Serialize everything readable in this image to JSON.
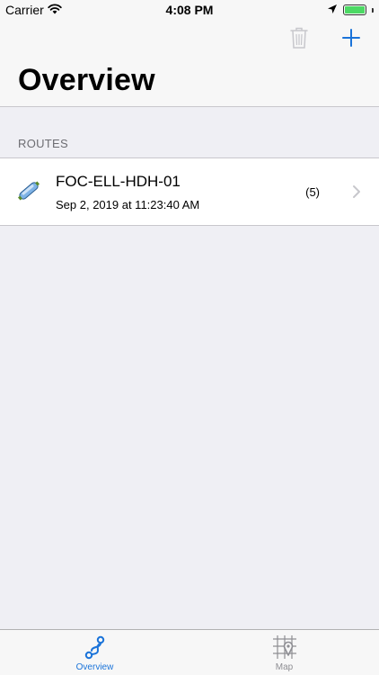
{
  "status_bar": {
    "carrier": "Carrier",
    "time": "4:08 PM",
    "battery_level": 1.0,
    "icons": [
      "wifi-icon",
      "location-arrow-icon",
      "battery-icon"
    ]
  },
  "nav": {
    "title": "Overview",
    "icons": [
      "trash-icon",
      "plus-icon"
    ],
    "trash_enabled": false,
    "accent_color": "#1a73d9"
  },
  "routes": {
    "section_header": "ROUTES",
    "items": [
      {
        "name": "FOC-ELL-HDH-01",
        "date": "Sep 2, 2019 at 11:23:40 AM",
        "count": "(5)",
        "icon": "cable-route-icon"
      }
    ]
  },
  "tab_bar": {
    "selected": "Overview",
    "tabs": [
      {
        "label": "Overview",
        "icon": "route-path-icon",
        "selected": true
      },
      {
        "label": "Map",
        "icon": "map-pin-icon",
        "selected": false
      }
    ]
  },
  "colors": {
    "accent": "#1a73d9",
    "background": "#efeff4",
    "battery": "#4cd964"
  }
}
